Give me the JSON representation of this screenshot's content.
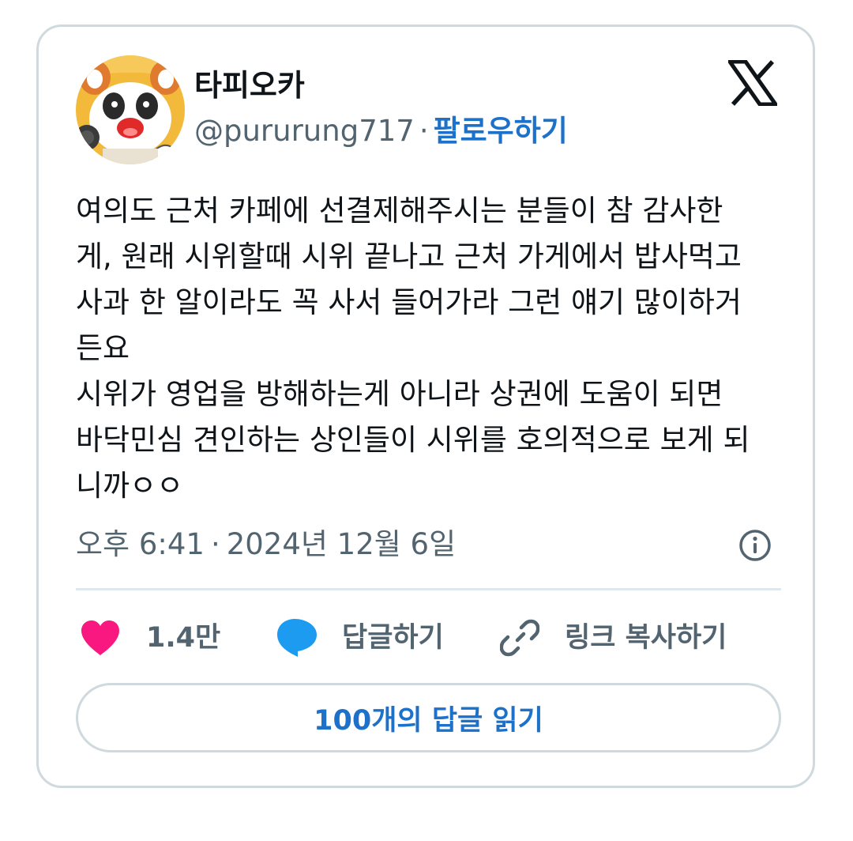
{
  "user": {
    "display_name": "타피오카",
    "handle": "@pururung717",
    "separator": "·",
    "follow_label": "팔로우하기",
    "avatar_icon": "red-panda-avatar-icon"
  },
  "platform": {
    "logo_icon": "x-logo-icon"
  },
  "tweet": {
    "text": "여의도 근처 카페에 선결제해주시는 분들이 참 감사한\n게, 원래 시위할때 시위 끝나고 근처 가게에서 밥사먹고\n사과 한 알이라도 꼭 사서 들어가라 그런 얘기 많이하거\n든요\n시위가 영업을 방해하는게 아니라 상권에 도움이 되면\n바닥민심 견인하는 상인들이 시위를 호의적으로 보게 되\n니까ㅇㅇ",
    "time": "오후 6:41",
    "separator": "·",
    "date": "2024년 12월 6일",
    "info_icon": "info-icon"
  },
  "actions": {
    "like_count": "1.4만",
    "like_icon": "heart-icon",
    "reply_label": "답글하기",
    "reply_icon": "speech-bubble-icon",
    "copy_link_label": "링크 복사하기",
    "copy_link_icon": "link-icon",
    "read_replies_label": "100개의 답글 읽기"
  },
  "colors": {
    "accent_blue": "#1d71c9",
    "like_pink": "#f91880",
    "reply_blue": "#1d9bf0",
    "muted_text": "#536471",
    "border": "#cfd9de"
  }
}
